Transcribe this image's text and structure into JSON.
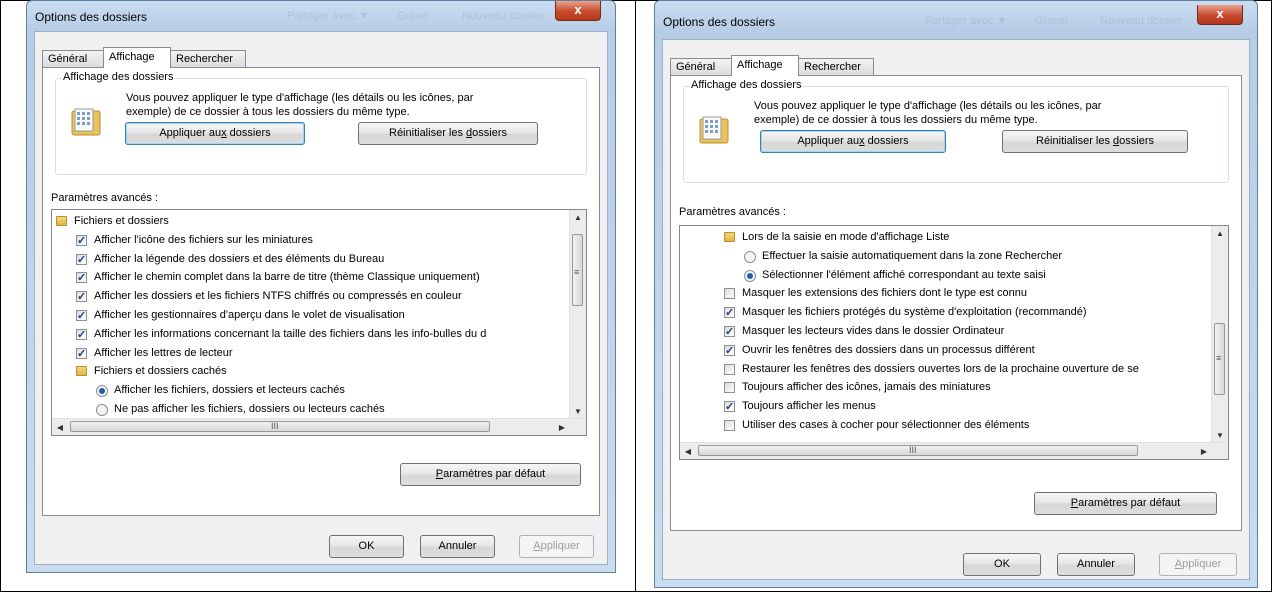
{
  "dialogs": [
    {
      "title": "Options des dossiers",
      "ghost_menu": [
        "Partager avec ▼",
        "Graver",
        "Nouveau dossier"
      ],
      "close_label": "x",
      "tabs": [
        "Général",
        "Affichage",
        "Rechercher"
      ],
      "active_tab": 1,
      "group": {
        "label": "Affichage des dossiers",
        "description": "Vous pouvez appliquer le type d'affichage (les détails ou les icônes, par exemple) de ce dossier à tous les dossiers du même type.",
        "apply_btn": {
          "pre": "Appliquer au",
          "u": "x",
          "post": " dossiers"
        },
        "reset_btn": {
          "pre": "Réinitialiser les ",
          "u": "d",
          "post": "ossiers"
        }
      },
      "advanced_label": "Paramètres avancés :",
      "tree_rows": [
        {
          "kind": "folder",
          "level": 0,
          "text": "Fichiers et dossiers"
        },
        {
          "kind": "check",
          "checked": true,
          "level": 1,
          "text": "Afficher l'icône des fichiers sur les miniatures"
        },
        {
          "kind": "check",
          "checked": true,
          "level": 1,
          "text": "Afficher la légende des dossiers et des éléments du Bureau"
        },
        {
          "kind": "check",
          "checked": true,
          "level": 1,
          "text": "Afficher le chemin complet dans la barre de titre (thème Classique uniquement)"
        },
        {
          "kind": "check",
          "checked": true,
          "level": 1,
          "text": "Afficher les dossiers et les fichiers NTFS chiffrés ou compressés en couleur"
        },
        {
          "kind": "check",
          "checked": true,
          "level": 1,
          "text": "Afficher les gestionnaires d'aperçu dans le volet de visualisation"
        },
        {
          "kind": "check",
          "checked": true,
          "level": 1,
          "text": "Afficher les informations concernant la taille des fichiers dans les info-bulles du d"
        },
        {
          "kind": "check",
          "checked": true,
          "level": 1,
          "text": "Afficher les lettres de lecteur"
        },
        {
          "kind": "folder",
          "level": 1,
          "text": "Fichiers et dossiers cachés"
        },
        {
          "kind": "radio",
          "checked": true,
          "level": 2,
          "text": "Afficher les fichiers, dossiers et lecteurs cachés"
        },
        {
          "kind": "radio",
          "checked": false,
          "level": 2,
          "text": "Ne pas afficher les fichiers, dossiers ou lecteurs cachés"
        }
      ],
      "scroll_position": 0.08,
      "hscroll_grip": "III",
      "defaults_btn": {
        "pre": "",
        "u": "P",
        "post": "aramètres par défaut"
      },
      "ok_label": "OK",
      "cancel_label": "Annuler",
      "apply_label": {
        "pre": "",
        "u": "A",
        "post": "ppliquer"
      }
    },
    {
      "title": "Options des dossiers",
      "ghost_menu": [
        "Partager avec ▼",
        "Graver",
        "Nouveau dossier"
      ],
      "close_label": "x",
      "tabs": [
        "Général",
        "Affichage",
        "Rechercher"
      ],
      "active_tab": 1,
      "group": {
        "label": "Affichage des dossiers",
        "description": "Vous pouvez appliquer le type d'affichage (les détails ou les icônes, par exemple) de ce dossier à tous les dossiers du même type.",
        "apply_btn": {
          "pre": "Appliquer au",
          "u": "x",
          "post": " dossiers"
        },
        "reset_btn": {
          "pre": "Réinitialiser les ",
          "u": "d",
          "post": "ossiers"
        }
      },
      "advanced_label": "Paramètres avancés :",
      "tree_rows": [
        {
          "kind": "folder",
          "level": 1,
          "text": "Lors de la saisie en mode d'affichage Liste"
        },
        {
          "kind": "radio",
          "checked": false,
          "level": 2,
          "text": "Effectuer la saisie automatiquement dans la zone Rechercher"
        },
        {
          "kind": "radio",
          "checked": true,
          "level": 2,
          "text": "Sélectionner l'élément affiché correspondant au texte saisi"
        },
        {
          "kind": "check",
          "checked": false,
          "level": 1,
          "text": "Masquer les extensions des fichiers dont le type est connu"
        },
        {
          "kind": "check",
          "checked": true,
          "level": 1,
          "text": "Masquer les fichiers protégés du système d'exploitation (recommandé)"
        },
        {
          "kind": "check",
          "checked": true,
          "level": 1,
          "text": "Masquer les lecteurs vides dans le dossier Ordinateur"
        },
        {
          "kind": "check",
          "checked": true,
          "level": 1,
          "text": "Ouvrir les fenêtres des dossiers dans un processus différent"
        },
        {
          "kind": "check",
          "checked": false,
          "level": 1,
          "text": "Restaurer les fenêtres des dossiers ouvertes lors de la prochaine ouverture de se"
        },
        {
          "kind": "check",
          "checked": false,
          "level": 1,
          "text": "Toujours afficher des icônes, jamais des miniatures"
        },
        {
          "kind": "check",
          "checked": true,
          "level": 1,
          "text": "Toujours afficher les menus"
        },
        {
          "kind": "check",
          "checked": false,
          "level": 1,
          "text": "Utiliser des cases à cocher pour sélectionner des éléments"
        }
      ],
      "scroll_position": 0.72,
      "hscroll_grip": "III",
      "defaults_btn": {
        "pre": "",
        "u": "P",
        "post": "aramètres par défaut"
      },
      "ok_label": "OK",
      "cancel_label": "Annuler",
      "apply_label": {
        "pre": "",
        "u": "A",
        "post": "ppliquer"
      }
    }
  ]
}
